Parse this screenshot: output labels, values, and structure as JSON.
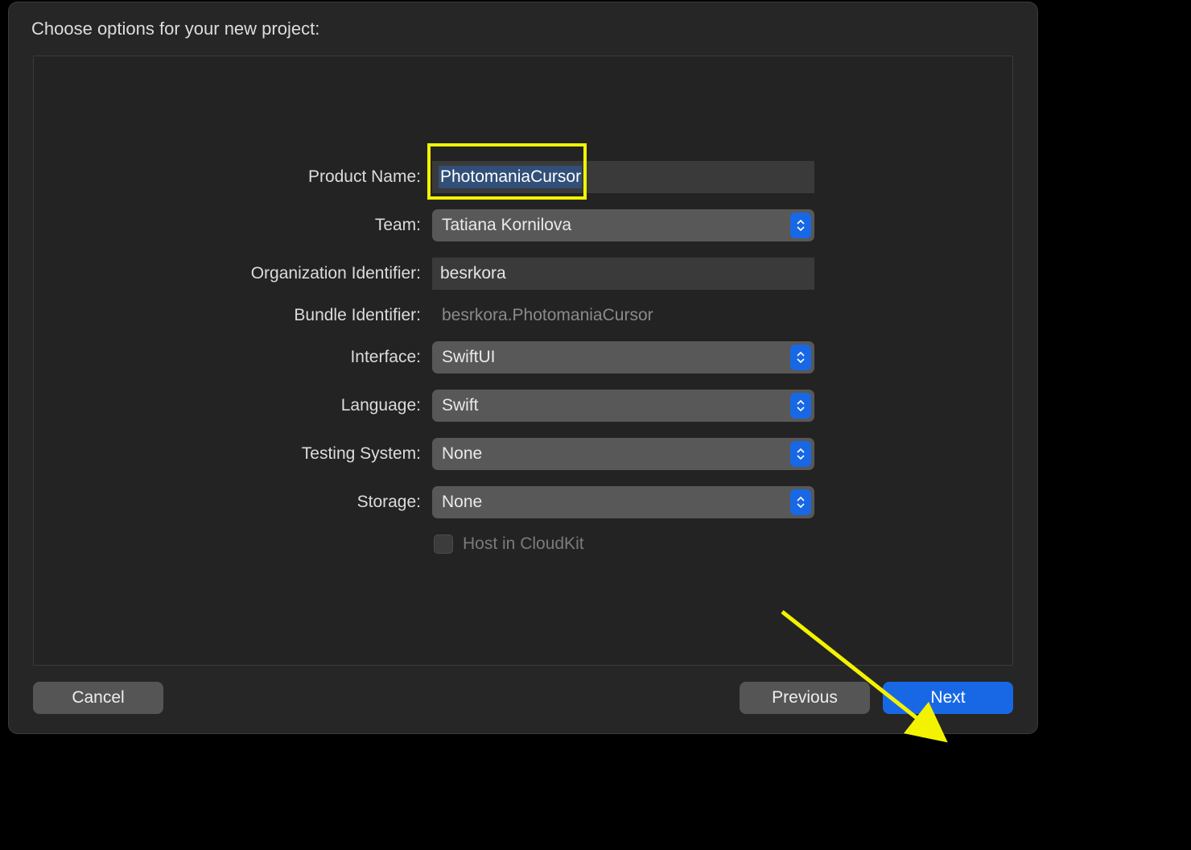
{
  "title": "Choose options for your new project:",
  "form": {
    "product_name_label": "Product Name:",
    "product_name_value": "PhotomaniaCursor",
    "team_label": "Team:",
    "team_value": "Tatiana Kornilova",
    "org_id_label": "Organization Identifier:",
    "org_id_value": "besrkora",
    "bundle_label": "Bundle Identifier:",
    "bundle_value": "besrkora.PhotomaniaCursor",
    "interface_label": "Interface:",
    "interface_value": "SwiftUI",
    "language_label": "Language:",
    "language_value": "Swift",
    "testing_label": "Testing System:",
    "testing_value": "None",
    "storage_label": "Storage:",
    "storage_value": "None",
    "cloudkit_label": "Host in CloudKit"
  },
  "buttons": {
    "cancel": "Cancel",
    "previous": "Previous",
    "next": "Next"
  }
}
